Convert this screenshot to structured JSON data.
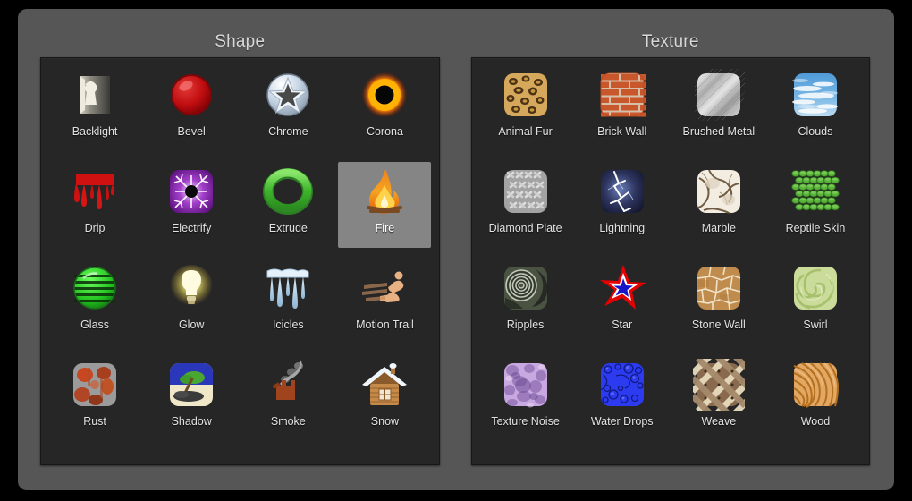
{
  "window": {
    "background_color": "#565656",
    "panel_color": "#262626",
    "selection_color": "#858585"
  },
  "panels": [
    {
      "id": "shape",
      "title": "Shape",
      "items": [
        {
          "label": "Backlight",
          "icon": "backlight-icon",
          "selected": false
        },
        {
          "label": "Bevel",
          "icon": "bevel-icon",
          "selected": false
        },
        {
          "label": "Chrome",
          "icon": "chrome-icon",
          "selected": false
        },
        {
          "label": "Corona",
          "icon": "corona-icon",
          "selected": false
        },
        {
          "label": "Drip",
          "icon": "drip-icon",
          "selected": false
        },
        {
          "label": "Electrify",
          "icon": "electrify-icon",
          "selected": false
        },
        {
          "label": "Extrude",
          "icon": "extrude-icon",
          "selected": false
        },
        {
          "label": "Fire",
          "icon": "fire-icon",
          "selected": true
        },
        {
          "label": "Glass",
          "icon": "glass-icon",
          "selected": false
        },
        {
          "label": "Glow",
          "icon": "glow-icon",
          "selected": false
        },
        {
          "label": "Icicles",
          "icon": "icicles-icon",
          "selected": false
        },
        {
          "label": "Motion Trail",
          "icon": "motion-trail-icon",
          "selected": false
        },
        {
          "label": "Rust",
          "icon": "rust-icon",
          "selected": false
        },
        {
          "label": "Shadow",
          "icon": "shadow-icon",
          "selected": false
        },
        {
          "label": "Smoke",
          "icon": "smoke-icon",
          "selected": false
        },
        {
          "label": "Snow",
          "icon": "snow-icon",
          "selected": false
        }
      ]
    },
    {
      "id": "texture",
      "title": "Texture",
      "items": [
        {
          "label": "Animal Fur",
          "icon": "animal-fur-icon",
          "selected": false
        },
        {
          "label": "Brick Wall",
          "icon": "brick-wall-icon",
          "selected": false
        },
        {
          "label": "Brushed Metal",
          "icon": "brushed-metal-icon",
          "selected": false
        },
        {
          "label": "Clouds",
          "icon": "clouds-icon",
          "selected": false
        },
        {
          "label": "Diamond Plate",
          "icon": "diamond-plate-icon",
          "selected": false
        },
        {
          "label": "Lightning",
          "icon": "lightning-icon",
          "selected": false
        },
        {
          "label": "Marble",
          "icon": "marble-icon",
          "selected": false
        },
        {
          "label": "Reptile Skin",
          "icon": "reptile-skin-icon",
          "selected": false
        },
        {
          "label": "Ripples",
          "icon": "ripples-icon",
          "selected": false
        },
        {
          "label": "Star",
          "icon": "star-icon",
          "selected": false
        },
        {
          "label": "Stone Wall",
          "icon": "stone-wall-icon",
          "selected": false
        },
        {
          "label": "Swirl",
          "icon": "swirl-icon",
          "selected": false
        },
        {
          "label": "Texture Noise",
          "icon": "texture-noise-icon",
          "selected": false
        },
        {
          "label": "Water Drops",
          "icon": "water-drops-icon",
          "selected": false
        },
        {
          "label": "Weave",
          "icon": "weave-icon",
          "selected": false
        },
        {
          "label": "Wood",
          "icon": "wood-icon",
          "selected": false
        }
      ]
    }
  ]
}
